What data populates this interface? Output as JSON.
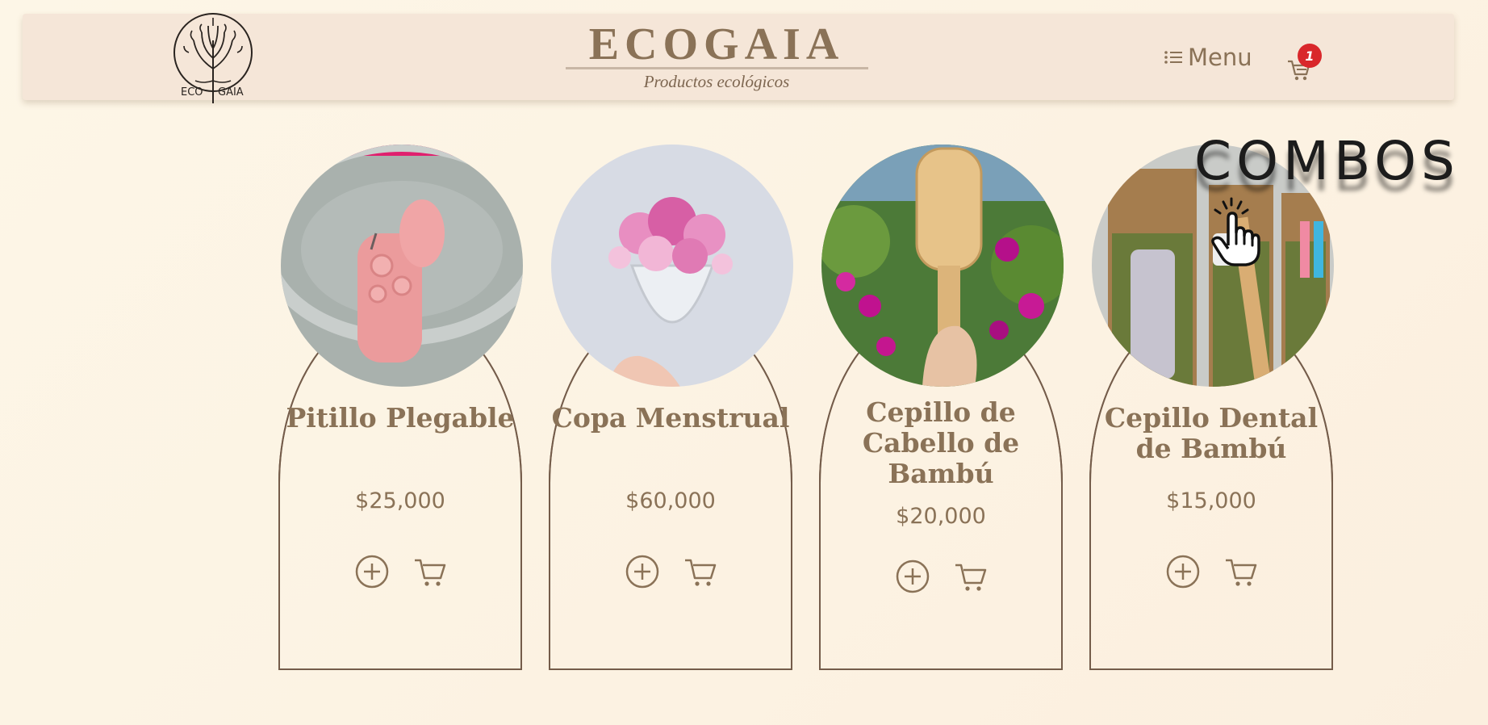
{
  "header": {
    "brand_title": "ECOGAIA",
    "brand_subtitle": "Productos ecológicos",
    "logo_text": "ECO GAIA",
    "menu_label": "Menu",
    "menu_icon": "list-icon",
    "cart_icon": "cart-icon",
    "cart_count": "1"
  },
  "combos": {
    "label": "COMBOS",
    "icon": "tap-hand-icon"
  },
  "products": [
    {
      "name": "Pitillo Plegable",
      "price": "$25,000",
      "image": "pink folding straw case"
    },
    {
      "name": "Copa Menstrual",
      "price": "$60,000",
      "image": "menstrual cup with pink flowers"
    },
    {
      "name": "Cepillo de Cabello de Bambú",
      "price": "$20,000",
      "image": "bamboo hairbrush with purple flowers"
    },
    {
      "name": "Cepillo Dental de Bambú",
      "price": "$15,000",
      "image": "bamboo toothbrushes packaging"
    }
  ],
  "product_actions": {
    "add_icon": "plus-circle-icon",
    "cart_icon": "cart-icon"
  },
  "colors": {
    "background": "#fdf6e7",
    "header": "#f5e6d8",
    "brand": "#8a7257",
    "card_border": "#745c4a",
    "badge": "#d9272b"
  }
}
